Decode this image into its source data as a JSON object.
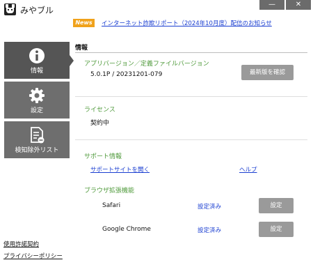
{
  "window": {
    "title": "みやブル",
    "minimize_label": "—",
    "close_label": "✕"
  },
  "news": {
    "badge": "News",
    "link_text": "インターネット詐欺リポート（2024年10月度）配信のお知らせ"
  },
  "sidebar": {
    "items": [
      {
        "label": "情報",
        "icon": "info-icon",
        "active": true
      },
      {
        "label": "設定",
        "icon": "gear-icon",
        "active": false
      },
      {
        "label": "検知除外リスト",
        "icon": "document-minus-icon",
        "active": false
      }
    ],
    "links": {
      "license": "使用許諾契約",
      "privacy": "プライバシーポリシー"
    }
  },
  "main": {
    "header": "情報",
    "version": {
      "label": "アプリバージョン／定義ファイルバージョン",
      "value": "5.0.1P / 20231201-079",
      "check_button": "最新版を確認"
    },
    "license": {
      "label": "ライセンス",
      "value": "契約中"
    },
    "support": {
      "label": "サポート情報",
      "site_link": "サポートサイトを開く",
      "help_link": "ヘルプ"
    },
    "extensions": {
      "label": "ブラウザ拡張機能",
      "items": [
        {
          "name": "Safari",
          "status": "設定済み",
          "button": "設定"
        },
        {
          "name": "Google Chrome",
          "status": "設定済み",
          "button": "設定"
        }
      ]
    }
  },
  "colors": {
    "accent_green": "#4f9a3b",
    "link_blue": "#1a3ed1",
    "news_orange": "#f0a21b",
    "nav_gray": "#6e6e6e",
    "nav_active": "#555555"
  }
}
